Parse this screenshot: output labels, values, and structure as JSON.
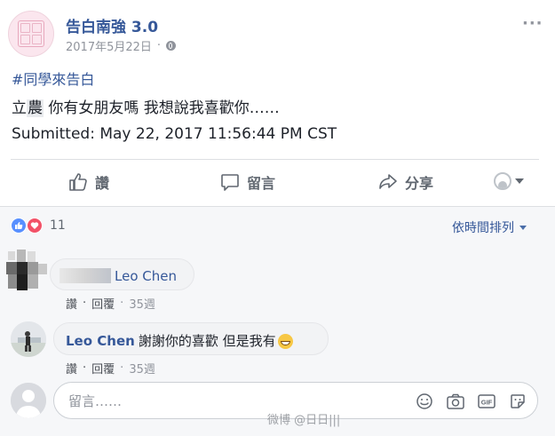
{
  "post": {
    "page_name": "告白南強 3.0",
    "date": "2017年5月22日",
    "hashtag": "#同學來告白",
    "body_prefix": "立",
    "body_tag": "農",
    "body_rest": " 你有女朋友嗎 我想說我喜歡你……",
    "submitted": "Submitted: May 22, 2017 11:56:44 PM CST"
  },
  "actions": {
    "like": "讚",
    "comment": "留言",
    "share": "分享"
  },
  "reactions": {
    "count": "11",
    "sort_label": "依時間排列"
  },
  "comments": [
    {
      "author": "Leo Chen",
      "text": "",
      "like": "讚",
      "reply": "回覆",
      "time": "35週"
    },
    {
      "author": "Leo Chen",
      "text": "謝謝你的喜歡 但是我有",
      "like": "讚",
      "reply": "回覆",
      "time": "35週"
    }
  ],
  "composer": {
    "placeholder": "留言……"
  },
  "watermark": "微博 @日日|||",
  "colors": {
    "link_blue": "#365899",
    "like_blue": "#5890ff",
    "love_red": "#f25268"
  }
}
